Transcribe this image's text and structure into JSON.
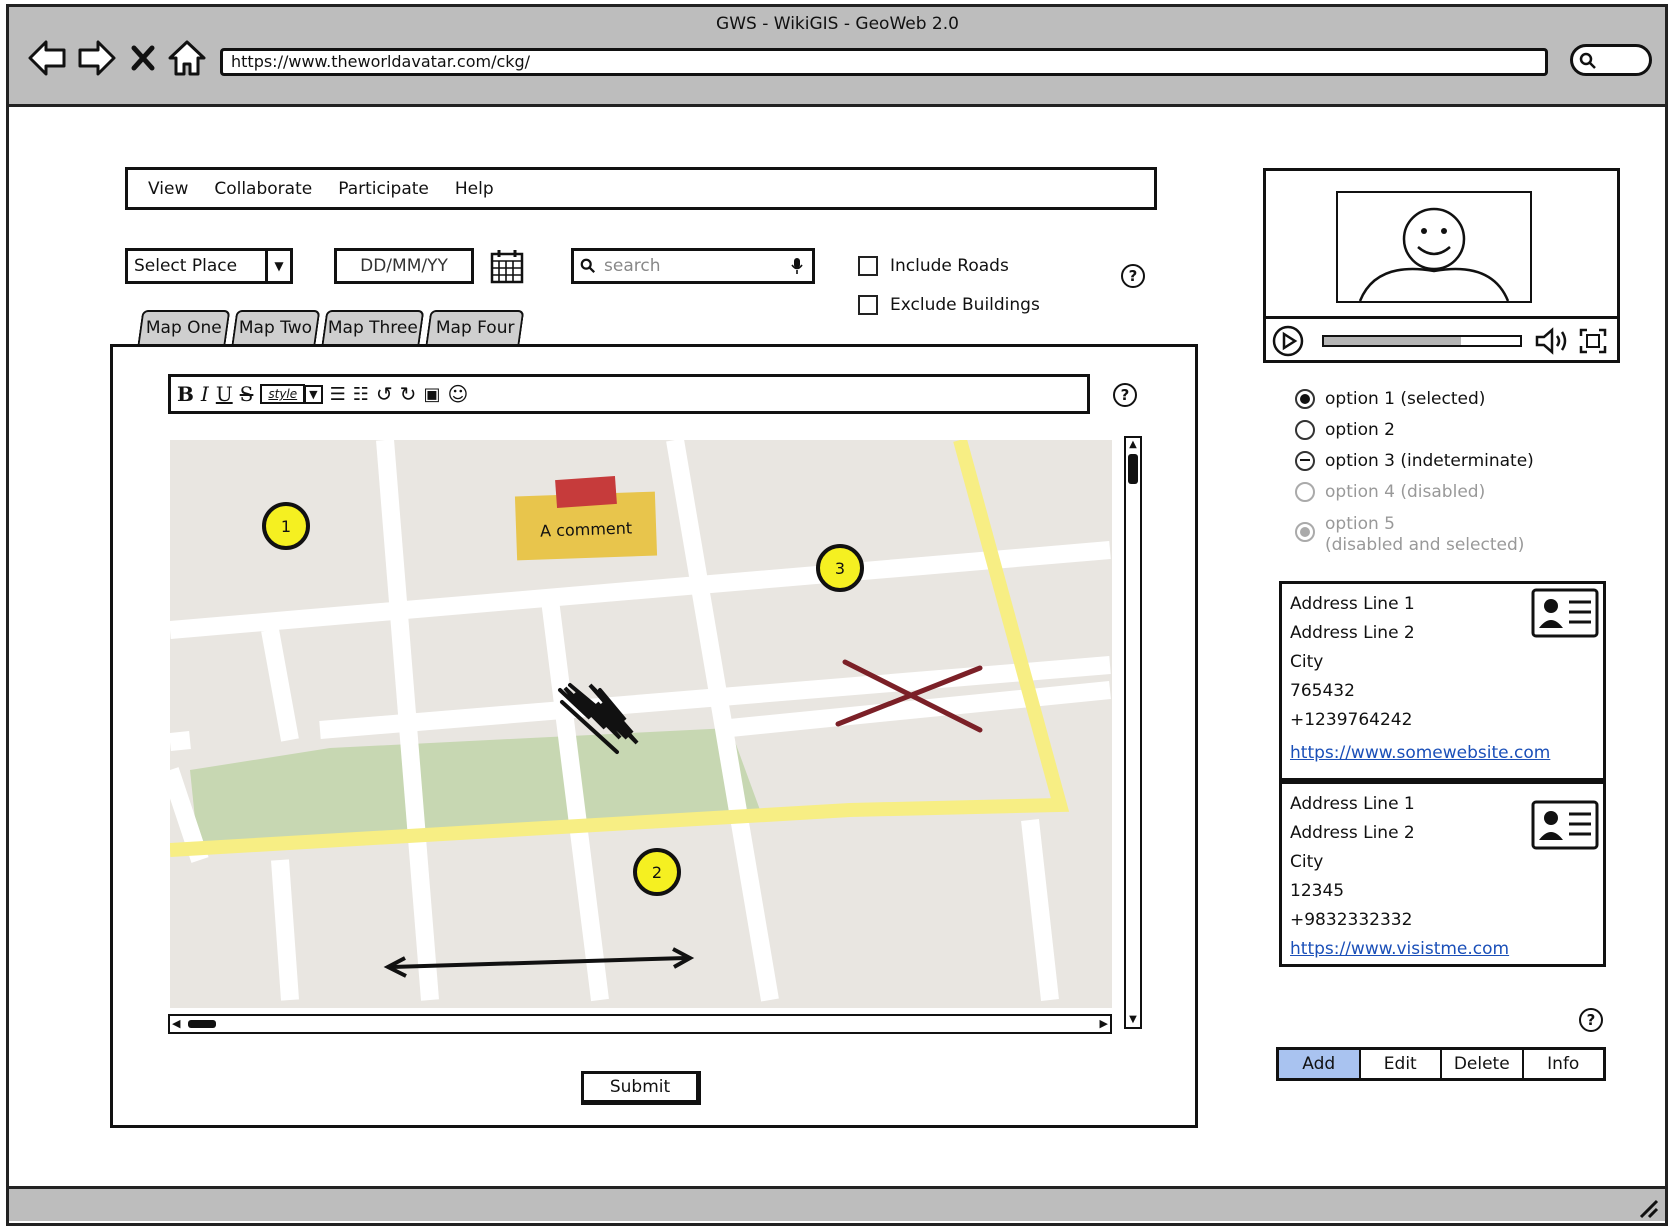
{
  "window": {
    "title": "GWS - WikiGIS - GeoWeb 2.0",
    "url": "https://www.theworldavatar.com/ckg/"
  },
  "menu": {
    "items": [
      "View",
      "Collaborate",
      "Participate",
      "Help"
    ]
  },
  "controls": {
    "select_place": "Select Place",
    "date_placeholder": "DD/MM/YY",
    "search_placeholder": "search",
    "include_roads": "Include Roads",
    "exclude_buildings": "Exclude Buildings"
  },
  "tabs": [
    "Map One",
    "Map Two",
    "Map Three",
    "Map Four"
  ],
  "editor": {
    "style_label": "style"
  },
  "map": {
    "pins": [
      "1",
      "2",
      "3"
    ],
    "comment": "A comment"
  },
  "submit_label": "Submit",
  "options": [
    {
      "label": "option 1 (selected)",
      "state": "selected"
    },
    {
      "label": "option 2",
      "state": "unselected"
    },
    {
      "label": "option 3 (indeterminate)",
      "state": "indeterminate"
    },
    {
      "label": "option 4 (disabled)",
      "state": "disabled"
    },
    {
      "label": "option 5",
      "sub": "(disabled and selected)",
      "state": "disabled-selected"
    }
  ],
  "cards": [
    {
      "line1": "Address Line 1",
      "line2": "Address Line 2",
      "city": "City",
      "zip": "765432",
      "phone": "+1239764242",
      "url": "https://www.somewebsite.com"
    },
    {
      "line1": "Address Line 1",
      "line2": "Address Line 2",
      "city": "City",
      "zip": "12345",
      "phone": "+9832332332",
      "url": "https://www.visistme.com"
    }
  ],
  "buttons": {
    "add": "Add",
    "edit": "Edit",
    "delete": "Delete",
    "info": "Info"
  },
  "colors": {
    "chrome": "#bdbdbd",
    "pin": "#f5f021",
    "selected_button": "#a9c3f0",
    "link": "#1a4fb8",
    "park": "#c7d7b2",
    "major_road": "#f7ee84"
  }
}
